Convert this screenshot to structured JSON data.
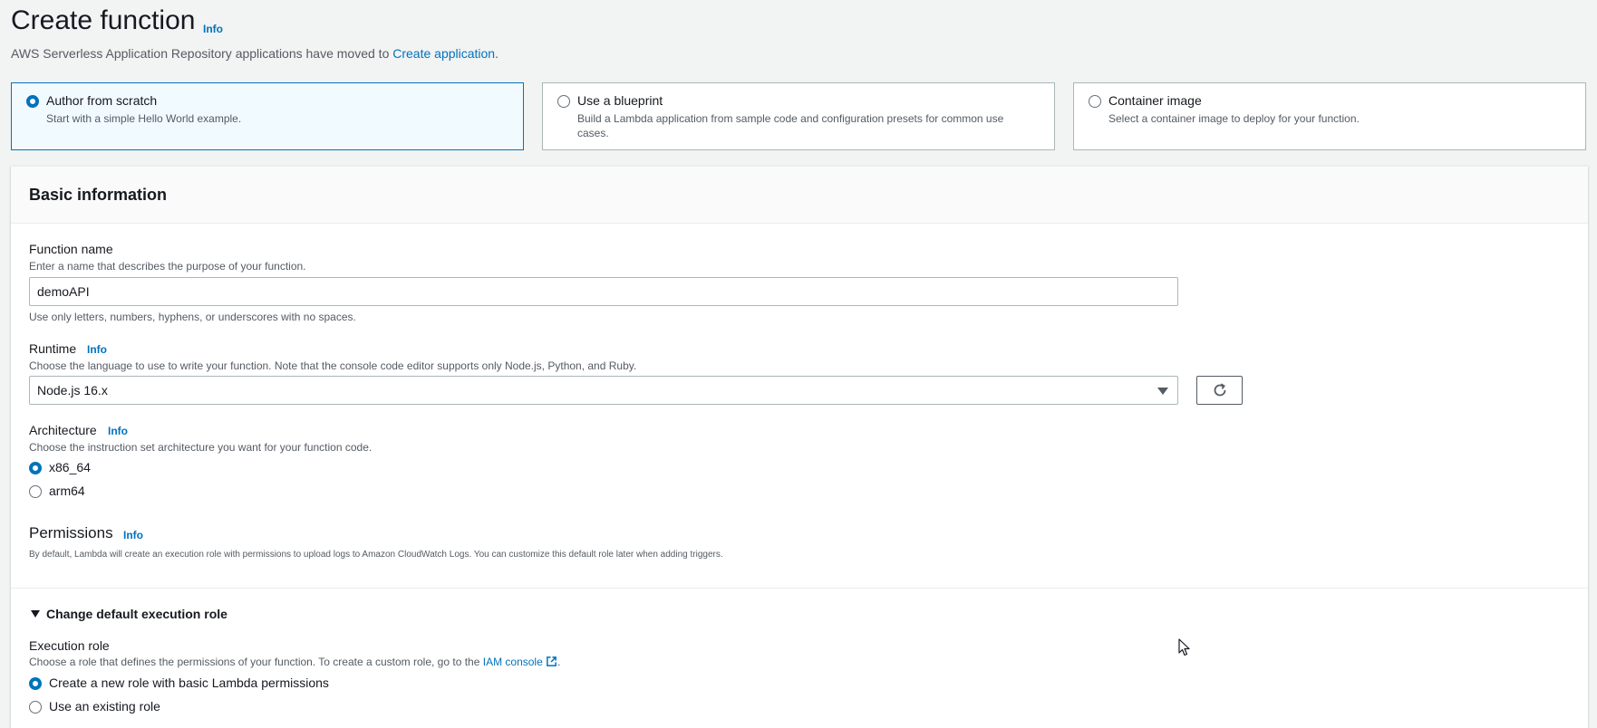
{
  "header": {
    "title": "Create function",
    "info": "Info",
    "moved_text": "AWS Serverless Application Repository applications have moved to ",
    "moved_link": "Create application",
    "moved_suffix": "."
  },
  "options": [
    {
      "title": "Author from scratch",
      "desc": "Start with a simple Hello World example.",
      "selected": true
    },
    {
      "title": "Use a blueprint",
      "desc": "Build a Lambda application from sample code and configuration presets for common use cases.",
      "selected": false
    },
    {
      "title": "Container image",
      "desc": "Select a container image to deploy for your function.",
      "selected": false
    }
  ],
  "basic": {
    "title": "Basic information",
    "function_name": {
      "label": "Function name",
      "desc": "Enter a name that describes the purpose of your function.",
      "value": "demoAPI",
      "hint": "Use only letters, numbers, hyphens, or underscores with no spaces."
    },
    "runtime": {
      "label": "Runtime",
      "info": "Info",
      "desc": "Choose the language to use to write your function. Note that the console code editor supports only Node.js, Python, and Ruby.",
      "value": "Node.js 16.x"
    },
    "architecture": {
      "label": "Architecture",
      "info": "Info",
      "desc": "Choose the instruction set architecture you want for your function code.",
      "options": [
        "x86_64",
        "arm64"
      ],
      "selected": "x86_64"
    },
    "permissions": {
      "label": "Permissions",
      "info": "Info",
      "desc": "By default, Lambda will create an execution role with permissions to upload logs to Amazon CloudWatch Logs. You can customize this default role later when adding triggers."
    },
    "execution": {
      "expander": "Change default execution role",
      "label": "Execution role",
      "desc_prefix": "Choose a role that defines the permissions of your function. To create a custom role, go to the ",
      "desc_link": "IAM console",
      "desc_suffix": ".",
      "options": [
        "Create a new role with basic Lambda permissions",
        "Use an existing role"
      ],
      "selected": "Create a new role with basic Lambda permissions"
    }
  },
  "colors": {
    "accent": "#0073bb",
    "selected_card_bg": "#f1faff"
  },
  "icons": [
    "refresh-icon",
    "external-link-icon",
    "caret-down-icon",
    "mouse-cursor-icon"
  ]
}
